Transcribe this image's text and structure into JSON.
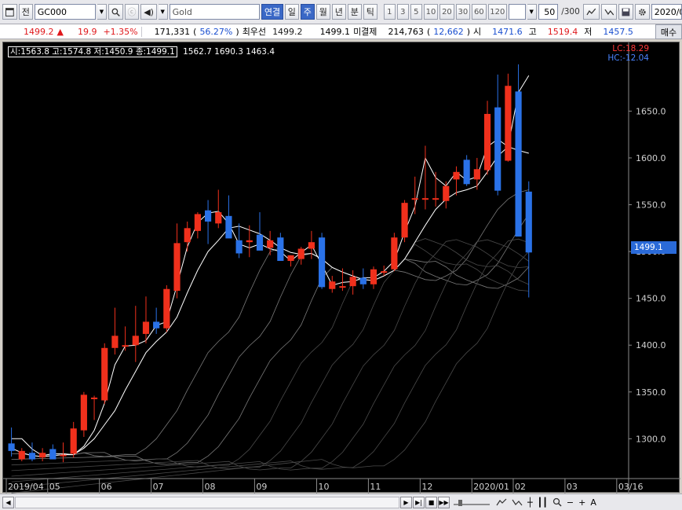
{
  "toolbar": {
    "market_label": "전",
    "symbol_code": "GC000",
    "symbol_name": "Gold",
    "mode_link": "연결",
    "period_tabs": [
      "일",
      "주",
      "월",
      "년",
      "분",
      "틱"
    ],
    "active_period": "주",
    "interval_numbers": [
      "1",
      "3",
      "5",
      "10",
      "20",
      "30",
      "60",
      "120"
    ],
    "count_value": "50",
    "count_total": "/300",
    "date_field": "2020/0"
  },
  "quote": {
    "price": "1499.2",
    "change_arrow": "▲",
    "change": "19.9",
    "change_pct": "+1.35%",
    "volume": "171,331",
    "volume_pct": "56.27%",
    "best_label": "최우선",
    "best_ask": "1499.2",
    "best_bid": "1499.1",
    "oi_label": "미결제",
    "open_interest": "214,763",
    "oi_change": "12,662",
    "open_label": "시",
    "open": "1471.6",
    "high_label": "고",
    "high": "1519.4",
    "low_label": "저",
    "low": "1457.5",
    "button": "매수"
  },
  "readout": {
    "boxed": "시:1563.8 고:1574.8 저:1450.9 종:1499.1",
    "extra": "1562.7 1690.3 1463.4",
    "lc": "LC:18.29",
    "hc": "HC:-12.04",
    "current_price_tag": "1499.1"
  },
  "colors": {
    "up": "#f0301c",
    "down": "#2a72e8",
    "background": "#000000",
    "ma_main": "#ffffff",
    "ma_secondary": "#8a8a8a"
  },
  "chart_data": {
    "type": "candlestick",
    "ylim": [
      1260,
      1720
    ],
    "y_ticks": [
      1300,
      1350,
      1400,
      1450,
      1500,
      1550,
      1600,
      1650
    ],
    "y_tick_labels": [
      "1300.0",
      "1350.0",
      "1400.0",
      "1450.0",
      "1500.0",
      "1550.0",
      "1600.0",
      "1650.0"
    ],
    "x_tick_labels": [
      "2019/04",
      "05",
      "06",
      "07",
      "08",
      "09",
      "10",
      "11",
      "12",
      "2020/01",
      "02",
      "03",
      "03/16"
    ],
    "x_tick_positions": [
      0,
      4,
      9,
      14,
      19,
      24,
      30,
      35,
      40,
      45,
      49,
      54,
      59
    ],
    "candles": [
      {
        "o": 1295,
        "h": 1312,
        "l": 1281,
        "c": 1287
      },
      {
        "o": 1278,
        "h": 1290,
        "l": 1276,
        "c": 1287
      },
      {
        "o": 1285,
        "h": 1296,
        "l": 1276,
        "c": 1278
      },
      {
        "o": 1280,
        "h": 1290,
        "l": 1276,
        "c": 1285
      },
      {
        "o": 1289,
        "h": 1294,
        "l": 1279,
        "c": 1278
      },
      {
        "o": 1283,
        "h": 1296,
        "l": 1275,
        "c": 1283
      },
      {
        "o": 1284,
        "h": 1318,
        "l": 1280,
        "c": 1311
      },
      {
        "o": 1309,
        "h": 1350,
        "l": 1302,
        "c": 1347
      },
      {
        "o": 1343,
        "h": 1346,
        "l": 1320,
        "c": 1344
      },
      {
        "o": 1341,
        "h": 1402,
        "l": 1337,
        "c": 1397
      },
      {
        "o": 1397,
        "h": 1440,
        "l": 1390,
        "c": 1410
      },
      {
        "o": 1400,
        "h": 1420,
        "l": 1394,
        "c": 1400
      },
      {
        "o": 1400,
        "h": 1442,
        "l": 1382,
        "c": 1410
      },
      {
        "o": 1412,
        "h": 1452,
        "l": 1402,
        "c": 1425
      },
      {
        "o": 1425,
        "h": 1440,
        "l": 1412,
        "c": 1418
      },
      {
        "o": 1418,
        "h": 1464,
        "l": 1414,
        "c": 1460
      },
      {
        "o": 1458,
        "h": 1530,
        "l": 1450,
        "c": 1509
      },
      {
        "o": 1510,
        "h": 1532,
        "l": 1500,
        "c": 1525
      },
      {
        "o": 1522,
        "h": 1542,
        "l": 1514,
        "c": 1540
      },
      {
        "o": 1544,
        "h": 1555,
        "l": 1508,
        "c": 1532
      },
      {
        "o": 1530,
        "h": 1566,
        "l": 1525,
        "c": 1542
      },
      {
        "o": 1538,
        "h": 1560,
        "l": 1522,
        "c": 1514
      },
      {
        "o": 1512,
        "h": 1530,
        "l": 1493,
        "c": 1498
      },
      {
        "o": 1510,
        "h": 1528,
        "l": 1494,
        "c": 1512
      },
      {
        "o": 1518,
        "h": 1542,
        "l": 1502,
        "c": 1501
      },
      {
        "o": 1504,
        "h": 1522,
        "l": 1496,
        "c": 1512
      },
      {
        "o": 1515,
        "h": 1520,
        "l": 1491,
        "c": 1490
      },
      {
        "o": 1490,
        "h": 1496,
        "l": 1484,
        "c": 1496
      },
      {
        "o": 1492,
        "h": 1505,
        "l": 1486,
        "c": 1503
      },
      {
        "o": 1503,
        "h": 1522,
        "l": 1492,
        "c": 1510
      },
      {
        "o": 1515,
        "h": 1520,
        "l": 1460,
        "c": 1462
      },
      {
        "o": 1460,
        "h": 1474,
        "l": 1456,
        "c": 1468
      },
      {
        "o": 1463,
        "h": 1482,
        "l": 1458,
        "c": 1463
      },
      {
        "o": 1463,
        "h": 1480,
        "l": 1454,
        "c": 1473
      },
      {
        "o": 1472,
        "h": 1482,
        "l": 1460,
        "c": 1465
      },
      {
        "o": 1465,
        "h": 1484,
        "l": 1460,
        "c": 1481
      },
      {
        "o": 1479,
        "h": 1485,
        "l": 1474,
        "c": 1479
      },
      {
        "o": 1481,
        "h": 1520,
        "l": 1479,
        "c": 1515
      },
      {
        "o": 1515,
        "h": 1555,
        "l": 1510,
        "c": 1552
      },
      {
        "o": 1556,
        "h": 1580,
        "l": 1540,
        "c": 1557
      },
      {
        "o": 1557,
        "h": 1613,
        "l": 1545,
        "c": 1557
      },
      {
        "o": 1556,
        "h": 1585,
        "l": 1548,
        "c": 1557
      },
      {
        "o": 1554,
        "h": 1575,
        "l": 1546,
        "c": 1570
      },
      {
        "o": 1577,
        "h": 1591,
        "l": 1560,
        "c": 1585
      },
      {
        "o": 1598,
        "h": 1603,
        "l": 1570,
        "c": 1572
      },
      {
        "o": 1577,
        "h": 1600,
        "l": 1566,
        "c": 1588
      },
      {
        "o": 1587,
        "h": 1661,
        "l": 1582,
        "c": 1647
      },
      {
        "o": 1654,
        "h": 1689,
        "l": 1560,
        "c": 1565
      },
      {
        "o": 1597,
        "h": 1690,
        "l": 1596,
        "c": 1677
      },
      {
        "o": 1671,
        "h": 1700,
        "l": 1590,
        "c": 1516
      },
      {
        "o": 1564,
        "h": 1575,
        "l": 1451,
        "c": 1499
      }
    ],
    "ma_short": [
      1300,
      1300,
      1289,
      1282,
      1284,
      1284,
      1283,
      1292,
      1309,
      1338,
      1379,
      1399,
      1400,
      1405,
      1421,
      1425,
      1464,
      1505,
      1531,
      1541,
      1543,
      1530,
      1508,
      1504,
      1508,
      1503,
      1500,
      1490,
      1499,
      1507,
      1486,
      1464,
      1467,
      1468,
      1472,
      1472,
      1479,
      1490,
      1521,
      1548,
      1600,
      1579,
      1570,
      1585,
      1576,
      1580,
      1612,
      1620,
      1612,
      1670,
      1688
    ],
    "ma_long": [
      1290,
      1285,
      1282,
      1281,
      1282,
      1283,
      1283,
      1290,
      1300,
      1315,
      1330,
      1352,
      1372,
      1392,
      1404,
      1414,
      1430,
      1456,
      1480,
      1500,
      1512,
      1525,
      1527,
      1523,
      1519,
      1512,
      1504,
      1499,
      1497,
      1498,
      1492,
      1483,
      1478,
      1474,
      1470,
      1469,
      1474,
      1480,
      1492,
      1510,
      1528,
      1545,
      1556,
      1563,
      1566,
      1570,
      1585,
      1602,
      1612,
      1608,
      1605
    ]
  },
  "bottombar": {
    "zoom_minus": "−",
    "zoom_plus": "+",
    "font_label": "A"
  }
}
